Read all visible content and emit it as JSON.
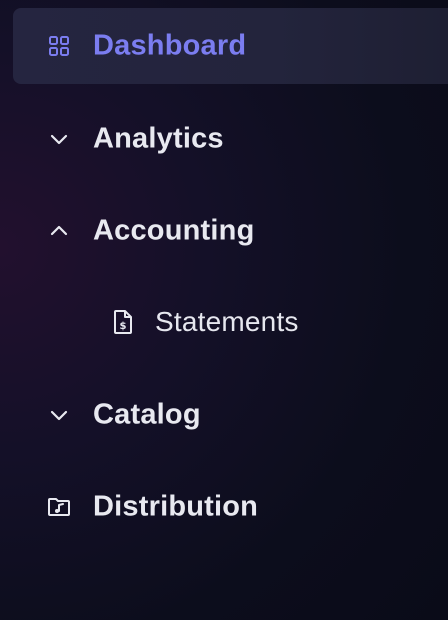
{
  "nav": {
    "items": [
      {
        "label": "Dashboard",
        "icon": "grid-icon",
        "active": true
      },
      {
        "label": "Analytics",
        "icon": "chevron-down-icon",
        "expanded": false
      },
      {
        "label": "Accounting",
        "icon": "chevron-up-icon",
        "expanded": true,
        "children": [
          {
            "label": "Statements",
            "icon": "document-dollar-icon"
          }
        ]
      },
      {
        "label": "Catalog",
        "icon": "chevron-down-icon",
        "expanded": false
      },
      {
        "label": "Distribution",
        "icon": "music-folder-icon"
      }
    ]
  },
  "colors": {
    "accent": "#7b7df0",
    "text": "#e8e9f0",
    "active_bg": "#252540",
    "background": "#0c0d1c"
  }
}
